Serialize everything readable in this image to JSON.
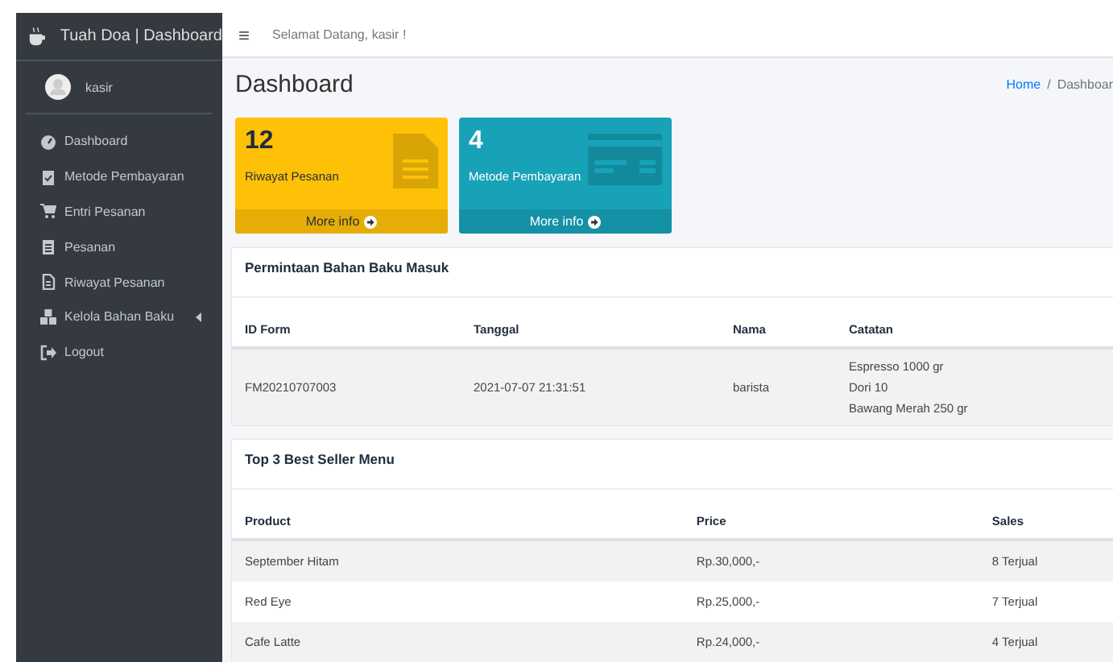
{
  "brand": {
    "title": "Tuah Doa | Dashboard"
  },
  "user": {
    "name": "kasir"
  },
  "sidebar": {
    "items": [
      {
        "label": "Dashboard",
        "kind": "gauge"
      },
      {
        "label": "Metode Pembayaran",
        "kind": "clipboard"
      },
      {
        "label": "Entri Pesanan",
        "kind": "cart"
      },
      {
        "label": "Pesanan",
        "kind": "paste"
      },
      {
        "label": "Riwayat Pesanan",
        "kind": "file"
      },
      {
        "label": "Kelola Bahan Baku",
        "kind": "boxes",
        "expanded": false
      },
      {
        "label": "Logout",
        "kind": "logout"
      }
    ]
  },
  "navbar": {
    "menu_icon": "≡",
    "greeting": "Selamat Datang, kasir !"
  },
  "page": {
    "title": "Dashboard",
    "breadcrumb_separator": "/",
    "breadcrumb": [
      {
        "label": "Home",
        "kind": "link"
      },
      {
        "label": "Dashboar",
        "kind": "current"
      }
    ]
  },
  "cards": [
    {
      "value": "12",
      "label": "Riwayat Pesanan",
      "link": "More info",
      "color": "#ffc107",
      "kind": "file"
    },
    {
      "value": "4",
      "label": "Metode Pembayaran",
      "link": "More info",
      "color": "#17a2b8",
      "kind": "card"
    }
  ],
  "requests": {
    "title": "Permintaan Bahan Baku Masuk",
    "columns": [
      "ID Form",
      "Tanggal",
      "Nama",
      "Catatan"
    ],
    "rows": [
      {
        "cells": [
          "FM20210707003",
          "2021-07-07 21:31:51",
          "barista"
        ],
        "notes": [
          "Espresso 1000 gr",
          "Dori 10",
          "Bawang Merah 250 gr"
        ]
      }
    ]
  },
  "bestsellers": {
    "title": "Top 3 Best Seller Menu",
    "columns": [
      "Product",
      "Price",
      "Sales"
    ],
    "rows": [
      [
        "September Hitam",
        "Rp.30,000,-",
        "8 Terjual"
      ],
      [
        "Red Eye",
        "Rp.25,000,-",
        "7 Terjual"
      ],
      [
        "Cafe Latte",
        "Rp.24,000,-",
        "4 Terjual"
      ]
    ]
  }
}
